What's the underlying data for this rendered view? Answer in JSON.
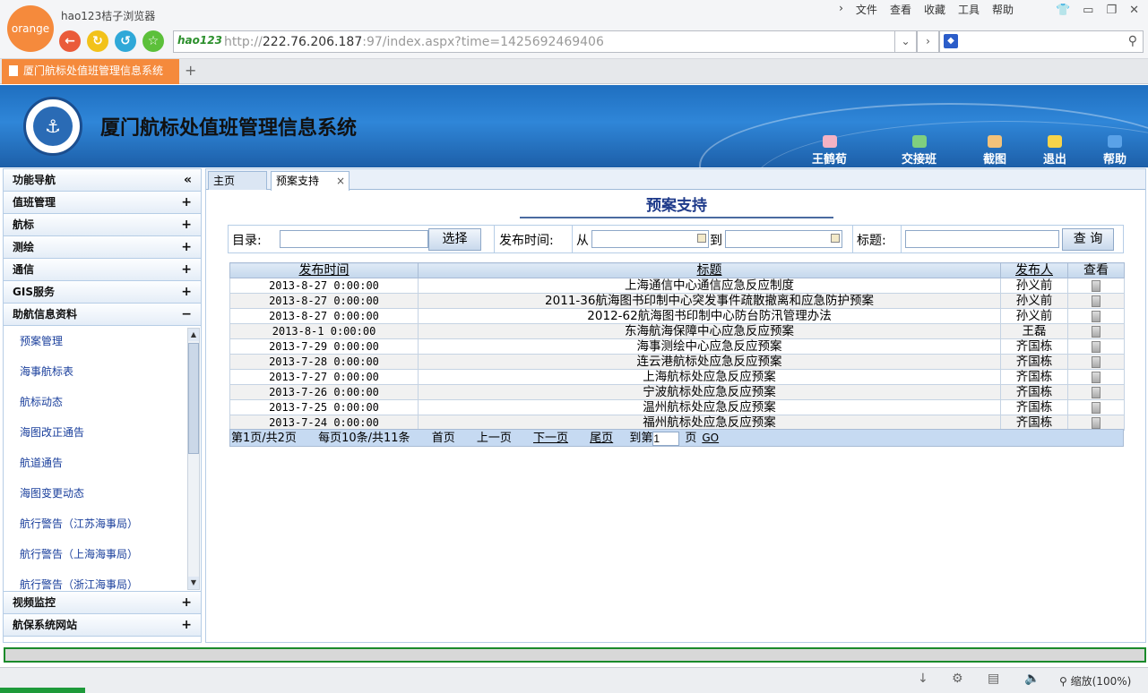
{
  "browser": {
    "logo_text": "orange",
    "app_title": "hao123桔子浏览器",
    "menu": [
      "文件",
      "查看",
      "收藏",
      "工具",
      "帮助"
    ],
    "address_logo": "hao123",
    "url_prefix": "http://",
    "url_host": "222.76.206.187",
    "url_rest": ":97/index.aspx?time=1425692469406",
    "tab_title": "厦门航标处值班管理信息系统",
    "new_tab": "+",
    "zoom": "缩放(100%)"
  },
  "header": {
    "title": "厦门航标处值班管理信息系统",
    "emblem_text": "CHINA MSA",
    "tools": [
      {
        "label": "王鹤荀",
        "color": "#f3b2c4"
      },
      {
        "label": "交接班",
        "color": "#7fcf7f"
      },
      {
        "label": "截图",
        "color": "#f2c27a"
      },
      {
        "label": "退出",
        "color": "#f7d44a"
      },
      {
        "label": "帮助",
        "color": "#5aa2e8"
      }
    ]
  },
  "sidebar": {
    "title": "功能导航",
    "collapse": "«",
    "sections_top": [
      {
        "label": "值班管理",
        "state": "+"
      },
      {
        "label": "航标",
        "state": "+"
      },
      {
        "label": "测绘",
        "state": "+"
      },
      {
        "label": "通信",
        "state": "+"
      },
      {
        "label": "GIS服务",
        "state": "+"
      }
    ],
    "open_section": {
      "label": "助航信息资料",
      "state": "−"
    },
    "items": [
      "预案管理",
      "海事航标表",
      "航标动态",
      "海图改正通告",
      "航道通告",
      "海图变更动态",
      "航行警告（江苏海事局）",
      "航行警告（上海海事局）",
      "航行警告（浙江海事局）"
    ],
    "sections_bottom": [
      {
        "label": "视频监控",
        "state": "+"
      },
      {
        "label": "航保系统网站",
        "state": "+"
      }
    ]
  },
  "content": {
    "tabs": [
      "主页",
      "预案支持"
    ],
    "tab_close": "×",
    "page_title": "预案支持",
    "filter": {
      "dir_label": "目录:",
      "select_button": "选择",
      "time_label": "发布时间:",
      "from_label": "从",
      "to_label": "到",
      "title_label": "标题:",
      "query_button": "查 询",
      "dir_value": "",
      "from_value": "",
      "to_value": "",
      "title_value": ""
    },
    "table": {
      "columns": [
        "发布时间",
        "标题",
        "发布人",
        "查看"
      ],
      "rows": [
        {
          "date": "2013-8-27 0:00:00",
          "title": "上海通信中心通信应急反应制度",
          "publisher": "孙义前"
        },
        {
          "date": "2013-8-27 0:00:00",
          "title": "2011-36航海图书印制中心突发事件疏散撤离和应急防护预案",
          "publisher": "孙义前"
        },
        {
          "date": "2013-8-27 0:00:00",
          "title": "2012-62航海图书印制中心防台防汛管理办法",
          "publisher": "孙义前"
        },
        {
          "date": "2013-8-1 0:00:00",
          "title": "东海航海保障中心应急反应预案",
          "publisher": "王磊"
        },
        {
          "date": "2013-7-29 0:00:00",
          "title": "海事测绘中心应急反应预案",
          "publisher": "齐国栋"
        },
        {
          "date": "2013-7-28 0:00:00",
          "title": "连云港航标处应急反应预案",
          "publisher": "齐国栋"
        },
        {
          "date": "2013-7-27 0:00:00",
          "title": "上海航标处应急反应预案",
          "publisher": "齐国栋"
        },
        {
          "date": "2013-7-26 0:00:00",
          "title": "宁波航标处应急反应预案",
          "publisher": "齐国栋"
        },
        {
          "date": "2013-7-25 0:00:00",
          "title": "温州航标处应急反应预案",
          "publisher": "齐国栋"
        },
        {
          "date": "2013-7-24 0:00:00",
          "title": "福州航标处应急反应预案",
          "publisher": "齐国栋"
        }
      ]
    },
    "pager": {
      "page_info": "第1页/共2页",
      "count_info": "每页10条/共11条",
      "first": "首页",
      "prev": "上一页",
      "next": "下一页",
      "last": "尾页",
      "goto_prefix": "到第",
      "goto_value": "1",
      "goto_suffix": "页",
      "go": "GO"
    }
  }
}
